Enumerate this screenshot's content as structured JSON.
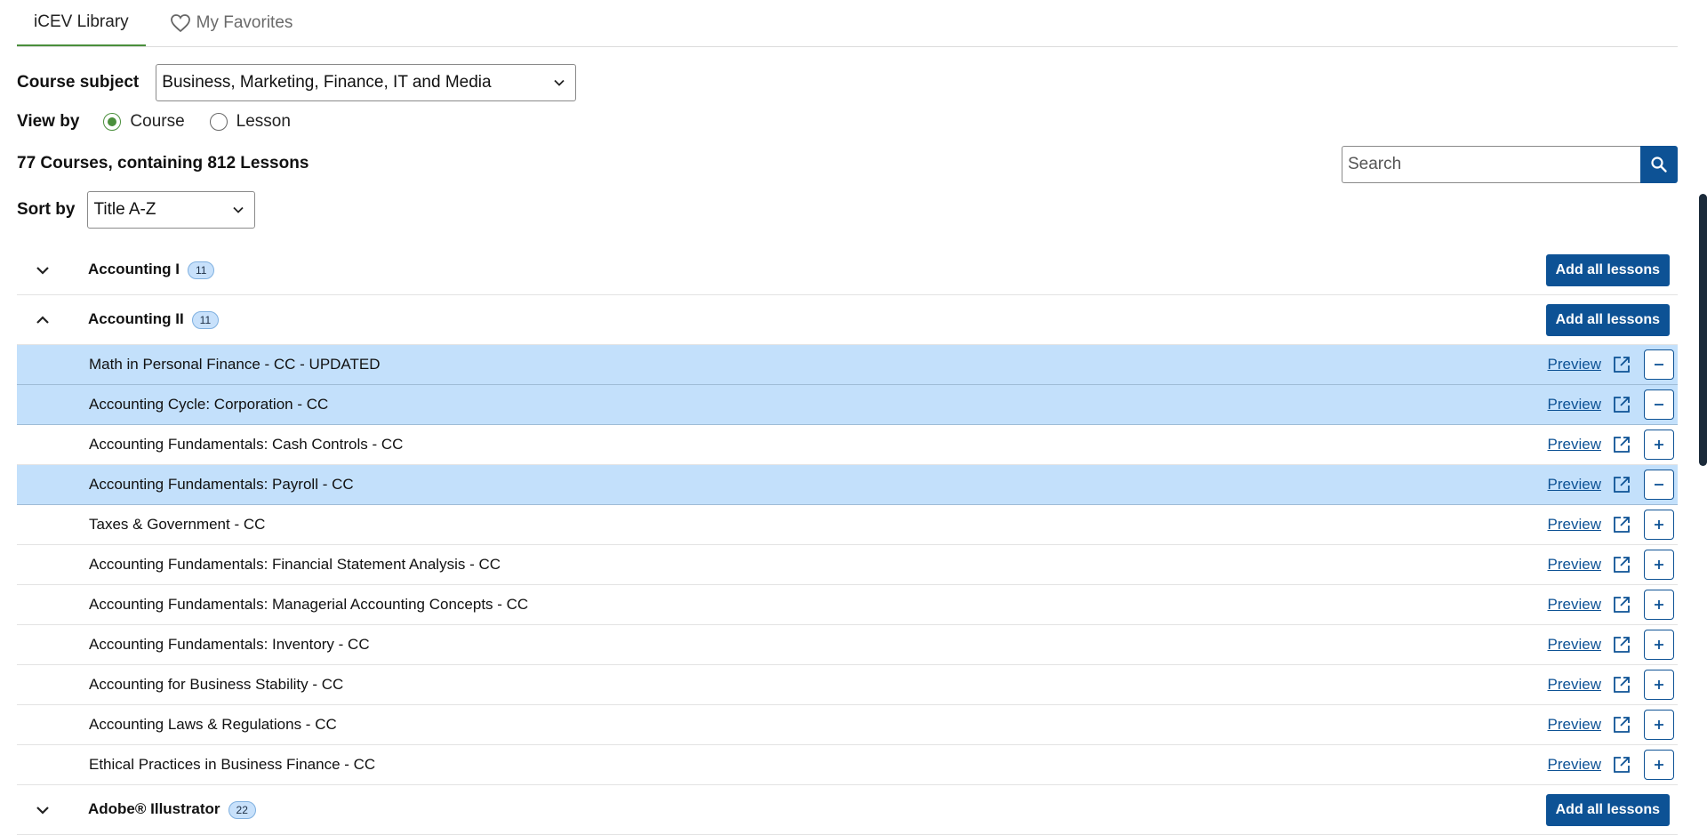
{
  "tabs": [
    {
      "label": "iCEV Library",
      "active": true
    },
    {
      "label": "My Favorites",
      "active": false,
      "icon": "heart-icon"
    }
  ],
  "course_subject": {
    "label": "Course subject",
    "value": "Business, Marketing, Finance, IT and Media"
  },
  "view_by": {
    "label": "View by",
    "options": [
      "Course",
      "Lesson"
    ],
    "selected": "Course"
  },
  "summary": "77 Courses, containing 812 Lessons",
  "search": {
    "placeholder": "Search",
    "icon": "search-icon"
  },
  "sort_by": {
    "label": "Sort by",
    "value": "Title A-Z"
  },
  "preview_label": "Preview",
  "add_all_label": "Add all lessons",
  "courses": [
    {
      "title": "Accounting I",
      "count": "11",
      "expanded": false
    },
    {
      "title": "Accounting II",
      "count": "11",
      "expanded": true
    },
    {
      "title": "Adobe® Illustrator",
      "count": "22",
      "expanded": false
    }
  ],
  "lessons": [
    {
      "title": "Math in Personal Finance - CC - UPDATED",
      "added": true
    },
    {
      "title": "Accounting Cycle: Corporation - CC",
      "added": true
    },
    {
      "title": "Accounting Fundamentals: Cash Controls - CC",
      "added": false
    },
    {
      "title": "Accounting Fundamentals: Payroll - CC",
      "added": true
    },
    {
      "title": "Taxes & Government - CC",
      "added": false
    },
    {
      "title": "Accounting Fundamentals: Financial Statement Analysis - CC",
      "added": false
    },
    {
      "title": "Accounting Fundamentals: Managerial Accounting Concepts - CC",
      "added": false
    },
    {
      "title": "Accounting Fundamentals: Inventory - CC",
      "added": false
    },
    {
      "title": "Accounting for Business Stability - CC",
      "added": false
    },
    {
      "title": "Accounting Laws & Regulations - CC",
      "added": false
    },
    {
      "title": "Ethical Practices in Business Finance - CC",
      "added": false
    }
  ],
  "colors": {
    "accent": "#0d5295",
    "selected_row": "#c3e0fb",
    "tab_underline": "#4a8f3c"
  }
}
